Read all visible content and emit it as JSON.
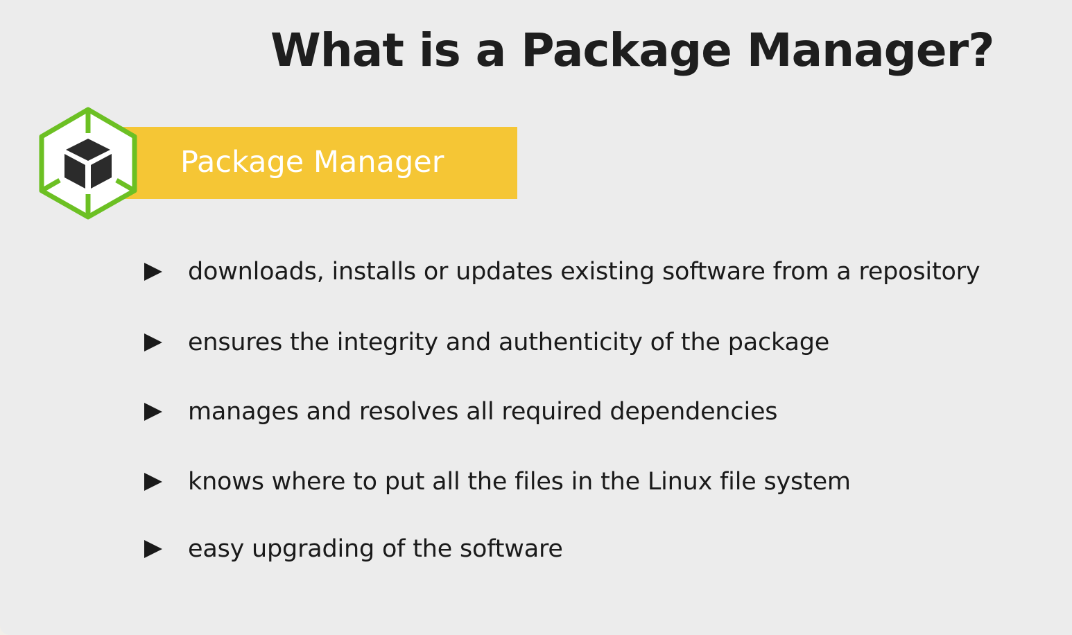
{
  "slide": {
    "title": "What is a Package Manager?",
    "banner_label": "Package Manager",
    "logo_icon": "package-cube-icon",
    "colors": {
      "background": "#ececec",
      "banner": "#f5c635",
      "logo_green": "#6cc023",
      "logo_dark": "#2b2b2b",
      "text": "#1a1a1a"
    },
    "bullets": [
      {
        "icon": "triangle-right-icon",
        "text": "downloads, installs or updates existing software from a repository"
      },
      {
        "icon": "triangle-right-icon",
        "text": "ensures the integrity and authenticity of the package"
      },
      {
        "icon": "triangle-right-icon",
        "text": "manages and resolves all required dependencies"
      },
      {
        "icon": "triangle-right-icon",
        "text": "knows where to put all the files in the Linux file system"
      },
      {
        "icon": "triangle-right-icon",
        "text": "easy upgrading of the software"
      }
    ]
  }
}
